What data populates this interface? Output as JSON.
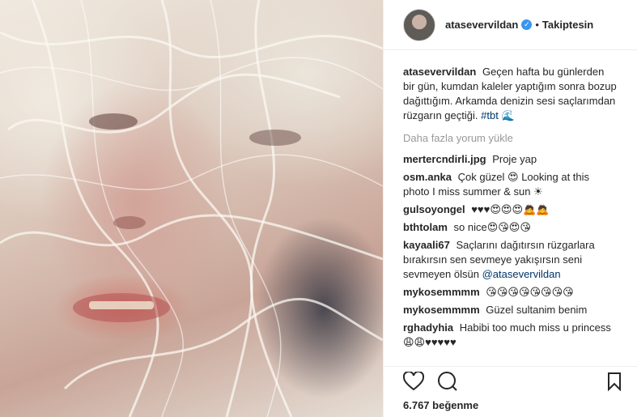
{
  "post": {
    "username": "atasevervildan",
    "verified_icon": "verified-badge-icon",
    "separator": "•",
    "follow_status": "Takiptesin"
  },
  "caption": {
    "user": "atasevervildan",
    "text": "Geçen hafta bu günlerden bir gün, kumdan kaleler yaptığım sonra bozup dağıttığım. Arkamda denizin sesi saçlarımdan rüzgarın geçtiği.",
    "hashtag": "#tbt",
    "emoji": "🌊"
  },
  "load_more": "Daha fazla yorum yükle",
  "comments": [
    {
      "user": "mertercndirli.jpg",
      "text": "Proje yap"
    },
    {
      "user": "osm.anka",
      "text": "Çok güzel 😍 Looking at this photo I miss summer & sun ☀"
    },
    {
      "user": "gulsoyongel",
      "text": "♥♥♥😍😍😍🙇🙇"
    },
    {
      "user": "bthtolam",
      "text": "so nice😍😘😍😘"
    },
    {
      "user": "kayaali67",
      "text": "Saçlarını dağıtırsın rüzgarlara bırakırsın sen sevmeye yakışırsın seni sevmeyen ölsün",
      "mention": "@atasevervildan"
    },
    {
      "user": "mykosemmmm",
      "text": "😘😘😘😘😘😘😘😘"
    },
    {
      "user": "mykosemmmm",
      "text": "Güzel sultanim benim"
    },
    {
      "user": "rghadyhia",
      "text": "Habibi too much miss u princess 😩😩♥♥♥♥♥"
    }
  ],
  "actions": {
    "like_icon": "heart-icon",
    "comment_icon": "comment-icon",
    "save_icon": "bookmark-icon"
  },
  "likes": "6.767 beğenme",
  "colors": {
    "link": "#003569",
    "verified": "#3897f0",
    "muted": "#999999",
    "text": "#262626"
  }
}
